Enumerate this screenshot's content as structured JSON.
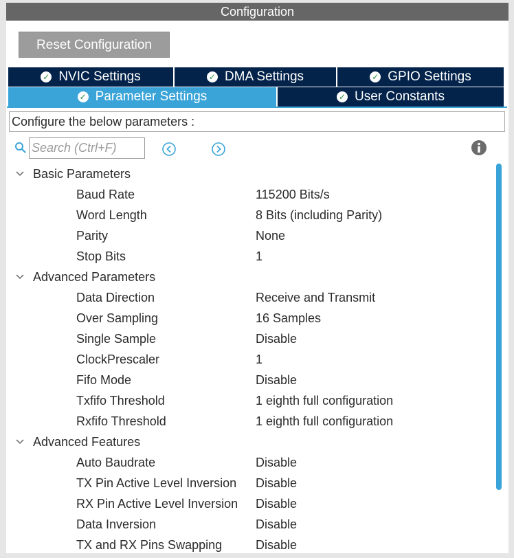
{
  "window": {
    "title": "Configuration"
  },
  "toolbar": {
    "reset_label": "Reset Configuration"
  },
  "tabs": {
    "nvic": "NVIC Settings",
    "dma": "DMA Settings",
    "gpio": "GPIO Settings",
    "parameter": "Parameter Settings",
    "user_constants": "User Constants",
    "active": "Parameter Settings"
  },
  "description": "Configure the below parameters :",
  "search": {
    "placeholder": "Search (Ctrl+F)"
  },
  "groups": [
    {
      "label": "Basic Parameters",
      "params": [
        {
          "label": "Baud Rate",
          "value": "115200 Bits/s"
        },
        {
          "label": "Word Length",
          "value": "8 Bits (including Parity)"
        },
        {
          "label": "Parity",
          "value": "None"
        },
        {
          "label": "Stop Bits",
          "value": "1"
        }
      ]
    },
    {
      "label": "Advanced Parameters",
      "params": [
        {
          "label": "Data Direction",
          "value": "Receive and Transmit"
        },
        {
          "label": "Over Sampling",
          "value": "16 Samples"
        },
        {
          "label": "Single Sample",
          "value": "Disable"
        },
        {
          "label": "ClockPrescaler",
          "value": "1"
        },
        {
          "label": "Fifo Mode",
          "value": "Disable"
        },
        {
          "label": "Txfifo Threshold",
          "value": "1 eighth full configuration"
        },
        {
          "label": "Rxfifo Threshold",
          "value": "1 eighth full configuration"
        }
      ]
    },
    {
      "label": "Advanced Features",
      "params": [
        {
          "label": "Auto Baudrate",
          "value": "Disable"
        },
        {
          "label": "TX Pin Active Level Inversion",
          "value": "Disable"
        },
        {
          "label": "RX Pin Active Level Inversion",
          "value": "Disable"
        },
        {
          "label": "Data Inversion",
          "value": "Disable"
        },
        {
          "label": "TX and RX Pins Swapping",
          "value": "Disable"
        }
      ]
    }
  ],
  "colors": {
    "tab_bg": "#03234b",
    "tab_active": "#3aa4d8",
    "title_bar": "#666666",
    "reset_button": "#9c9c9c"
  }
}
